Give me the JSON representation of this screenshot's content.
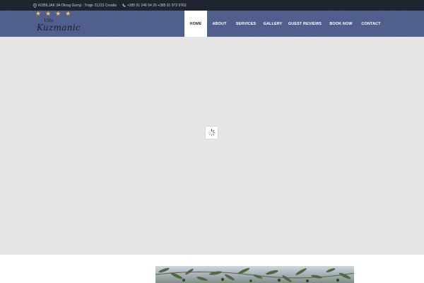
{
  "topbar": {
    "address": "KOBILJAK 3A Okrug Gornji - Trogir 21223 Croatia",
    "phones": "+385 91 246 64 26 +385 91 973 9763",
    "icons": [
      "map-pin-icon",
      "phone-icon"
    ]
  },
  "logo": {
    "villa": "Villa",
    "name": "Kuzmanic",
    "stars": [
      "★",
      "★",
      "★",
      "★"
    ]
  },
  "nav": {
    "items": [
      {
        "label": "HOME",
        "active": true
      },
      {
        "label": "ABOUT"
      },
      {
        "label": "SERVICES"
      },
      {
        "label": "GALLERY"
      },
      {
        "label": "GUEST REVIEWS"
      },
      {
        "label": "BOOK NOW"
      },
      {
        "label": "CONTACT"
      }
    ]
  },
  "colors": {
    "topbar_bg": "#1f2530",
    "header_bg": "#4e5d8c",
    "hero_bg": "#e6e6e6",
    "star": "#f2c94c"
  }
}
